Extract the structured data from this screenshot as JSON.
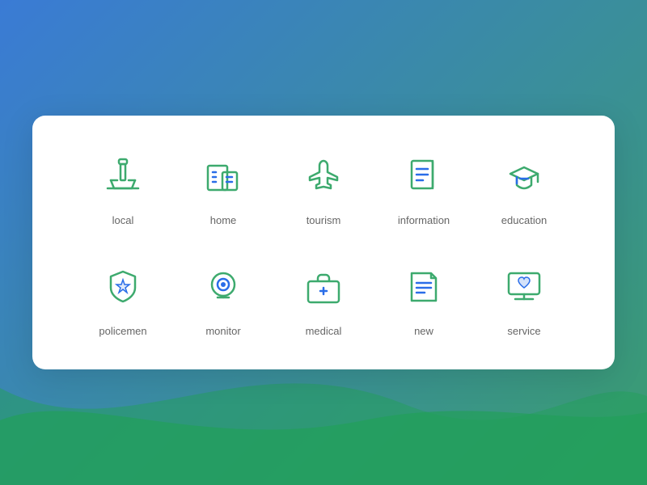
{
  "background": {
    "gradient_start": "#3a7bd5",
    "gradient_end": "#3a9d6e"
  },
  "card": {
    "items": [
      {
        "id": "local",
        "label": "local"
      },
      {
        "id": "home",
        "label": "home"
      },
      {
        "id": "tourism",
        "label": "tourism"
      },
      {
        "id": "information",
        "label": "information"
      },
      {
        "id": "education",
        "label": "education"
      },
      {
        "id": "policemen",
        "label": "policemen"
      },
      {
        "id": "monitor",
        "label": "monitor"
      },
      {
        "id": "medical",
        "label": "medical"
      },
      {
        "id": "new",
        "label": "new"
      },
      {
        "id": "service",
        "label": "service"
      }
    ]
  },
  "colors": {
    "green": "#3daa6e",
    "blue": "#2a6de8"
  }
}
